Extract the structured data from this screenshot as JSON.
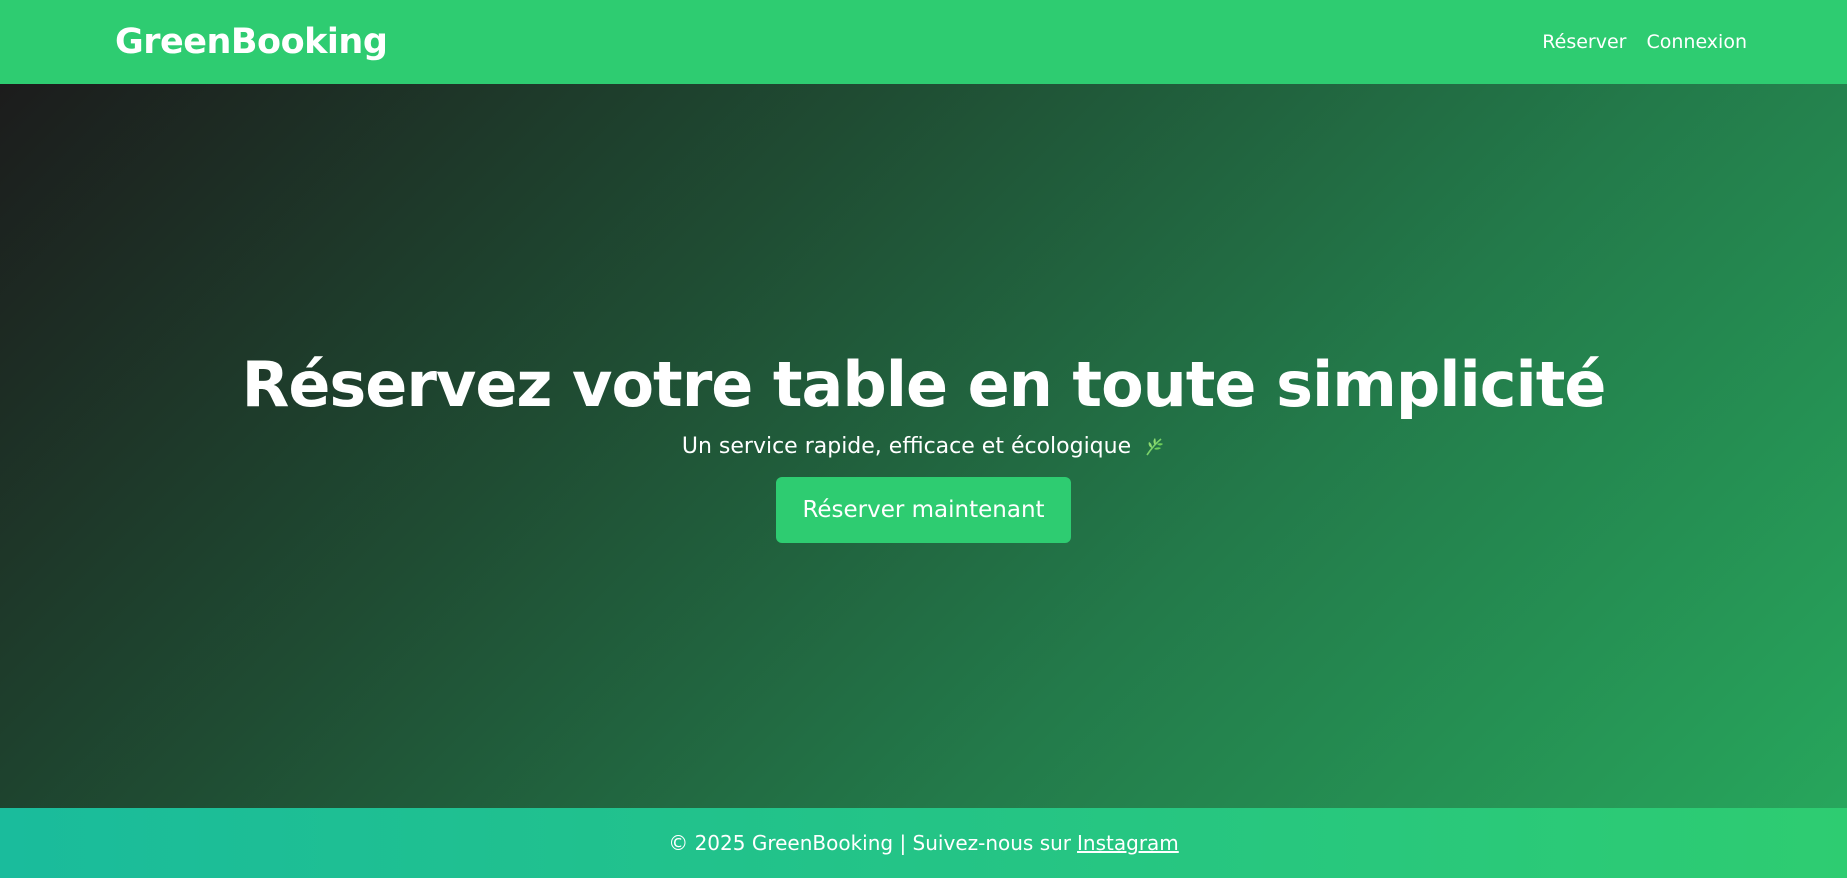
{
  "header": {
    "brand": "GreenBooking",
    "nav": [
      {
        "label": "Réserver"
      },
      {
        "label": "Connexion"
      }
    ]
  },
  "hero": {
    "title": "Réservez votre table en toute simplicité",
    "subtitle": "Un service rapide, efficace et écologique",
    "subtitle_icon": "leaf-icon",
    "cta_label": "Réserver maintenant"
  },
  "footer": {
    "text": "© 2025 GreenBooking | Suivez-nous sur",
    "link_label": "Instagram"
  },
  "colors": {
    "brand_green": "#2ecc71",
    "footer_teal": "#1abc9c",
    "hero_dark": "#1c1c1c"
  }
}
